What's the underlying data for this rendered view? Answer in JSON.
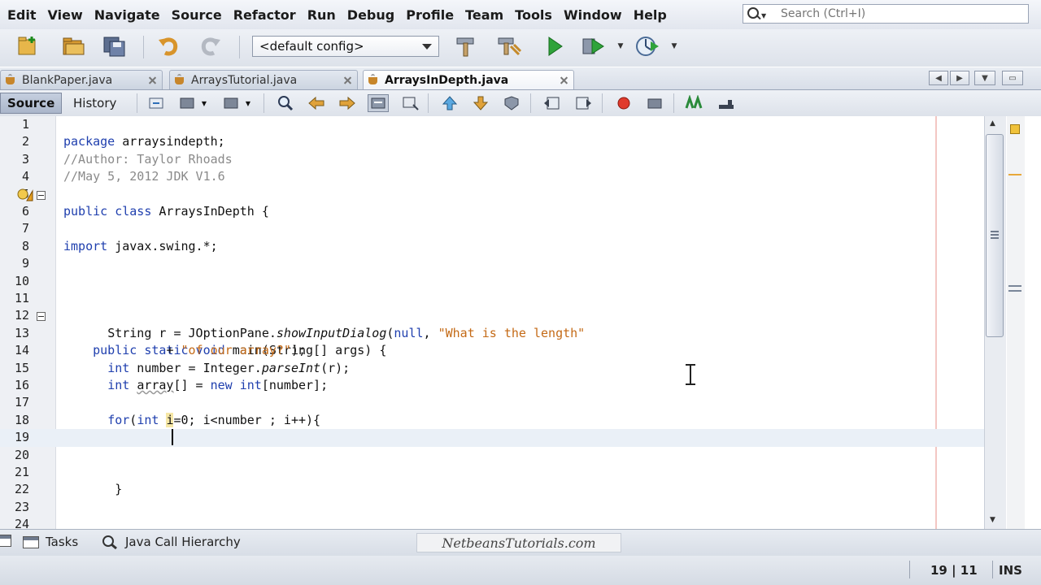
{
  "menu": {
    "items": [
      "Edit",
      "View",
      "Navigate",
      "Source",
      "Refactor",
      "Run",
      "Debug",
      "Profile",
      "Team",
      "Tools",
      "Window",
      "Help"
    ]
  },
  "search": {
    "placeholder": "Search (Ctrl+I)"
  },
  "toolbar": {
    "config_value": "<default config>"
  },
  "tabs": [
    {
      "label": "BlankPaper.java",
      "active": false
    },
    {
      "label": "ArraysTutorial.java",
      "active": false
    },
    {
      "label": "ArraysInDepth.java",
      "active": true
    }
  ],
  "editor_toolbar": {
    "source_label": "Source",
    "history_label": "History"
  },
  "editor": {
    "line_numbers": [
      "1",
      "2",
      "3",
      "4",
      "5",
      "6",
      "7",
      "8",
      "9",
      "10",
      "11",
      "12",
      "13",
      "14",
      "15",
      "16",
      "17",
      "18",
      "19",
      "20",
      "21",
      "22",
      "23",
      "24"
    ],
    "code": {
      "l2_kw": "package",
      "l2_rest": " arraysindepth;",
      "l3": "//Author: Taylor Rhoads",
      "l4": "//May 5, 2012 JDK V1.6",
      "l5_kw": "import",
      "l5_rest": " javax.swing.*;",
      "l6_kw": "public class",
      "l6_rest": " ArraysInDepth {",
      "l12_indent": "    ",
      "l12_kw": "public static void",
      "l12_rest": " main(String[] args) {",
      "l13_indent": "      ",
      "l13_a": "String r = JOptionPane.",
      "l13_method": "showInputDialog",
      "l13_b": "(",
      "l13_null": "null",
      "l13_c": ", ",
      "l13_str": "\"What is the length\"",
      "l14_indent": "              ",
      "l14_a": "+ ",
      "l14_str": "\"of our array?\"",
      "l14_b": ");",
      "l15_indent": "      ",
      "l15_kw": "int",
      "l15_a": " number = Integer.",
      "l15_method": "parseInt",
      "l15_b": "(r);",
      "l16_indent": "      ",
      "l16_kw": "int",
      "l16_a": " ",
      "l16_ul": "array",
      "l16_b": "[] = ",
      "l16_kw2": "new int",
      "l16_c": "[number];",
      "l18_indent": "      ",
      "l18_kw": "for",
      "l18_a": "(",
      "l18_kw2": "int",
      "l18_b": " ",
      "l18_hl": "i",
      "l18_c": "=0; i<number ; i++){",
      "l22_indent": "       ",
      "l22": "}"
    }
  },
  "bottom_panel": {
    "tasks_label": "Tasks",
    "hierarchy_label": "Java Call Hierarchy",
    "watermark": "NetbeansTutorials.com"
  },
  "status": {
    "position": "19 | 11",
    "mode": "INS"
  }
}
